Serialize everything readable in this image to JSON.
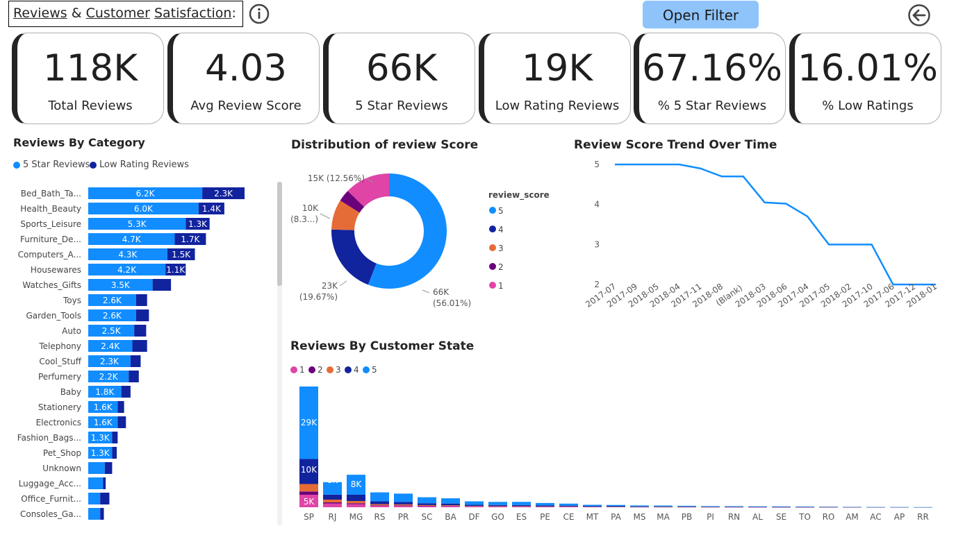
{
  "header": {
    "title_part1": "Reviews",
    "title_amp": " & ",
    "title_part2": "Customer",
    "title_space": " ",
    "title_part3": "Satisfaction",
    "title_colon": ":",
    "open_filter_label": "Open Filter",
    "more_options": "...",
    "info_icon": "info-icon",
    "back_icon": "back-arrow-icon"
  },
  "kpis": [
    {
      "value": "118K",
      "label": "Total Reviews"
    },
    {
      "value": "4.03",
      "label": "Avg Review Score"
    },
    {
      "value": "66K",
      "label": "5 Star Reviews"
    },
    {
      "value": "19K",
      "label": "Low Rating Reviews"
    },
    {
      "value": "67.16%",
      "label": "% 5 Star Reviews"
    },
    {
      "value": "16.01%",
      "label": "% Low Ratings"
    }
  ],
  "colors": {
    "five_star": "#118dff",
    "low_rating": "#12239e",
    "score5": "#118dff",
    "score4": "#12239e",
    "score3": "#e66c37",
    "score2": "#6b007b",
    "score1": "#e044a7",
    "line": "#118dff"
  },
  "category_chart": {
    "title": "Reviews By Category",
    "legend": [
      "5 Star Reviews",
      "Low Rating Reviews"
    ],
    "categories": [
      "Bed_Bath_Ta...",
      "Health_Beauty",
      "Sports_Leisure",
      "Furniture_De...",
      "Computers_A...",
      "Housewares",
      "Watches_Gifts",
      "Toys",
      "Garden_Tools",
      "Auto",
      "Telephony",
      "Cool_Stuff",
      "Perfumery",
      "Baby",
      "Stationery",
      "Electronics",
      "Fashion_Bags...",
      "Pet_Shop",
      "Unknown",
      "Luggage_Acc...",
      "Office_Furnit...",
      "Consoles_Ga..."
    ],
    "five_star": [
      6200,
      6000,
      5300,
      4700,
      4300,
      4200,
      3500,
      2600,
      2600,
      2500,
      2400,
      2300,
      2200,
      1800,
      1600,
      1600,
      1300,
      1300,
      900,
      800,
      650,
      650
    ],
    "low_rating": [
      2300,
      1400,
      1300,
      1700,
      1500,
      1100,
      1000,
      600,
      700,
      650,
      800,
      550,
      550,
      500,
      350,
      450,
      300,
      250,
      400,
      150,
      500,
      200
    ],
    "five_star_labels": [
      "6.2K",
      "6.0K",
      "5.3K",
      "4.7K",
      "4.3K",
      "4.2K",
      "3.5K",
      "2.6K",
      "2.6K",
      "2.5K",
      "2.4K",
      "2.3K",
      "2.2K",
      "1.8K",
      "1.6K",
      "1.6K",
      "1.3K",
      "1.3K",
      "",
      "",
      "",
      ""
    ],
    "low_rating_labels": [
      "2.3K",
      "1.4K",
      "1.3K",
      "1.7K",
      "1.5K",
      "1.1K",
      "",
      "",
      "",
      "",
      "",
      "",
      "",
      "",
      "",
      "",
      "",
      "",
      "",
      "",
      "",
      ""
    ]
  },
  "chart_data": [
    {
      "type": "pie",
      "title": "Distribution of review Score",
      "legend_title": "review_score",
      "labels": [
        "5",
        "4",
        "3",
        "2",
        "1"
      ],
      "values": [
        66000,
        23000,
        10000,
        4000,
        15000
      ],
      "percents": [
        56.01,
        19.67,
        8.3,
        3.4,
        12.56
      ],
      "data_labels": [
        "66K\n(56.01%)",
        "23K\n(19.67%)",
        "10K\n(8.3...)",
        "",
        "15K (12.56%)"
      ]
    },
    {
      "type": "line",
      "title": "Review Score Trend Over Time",
      "x": [
        "2017-07",
        "2017-09",
        "2018-05",
        "2018-04",
        "2017-11",
        "2018-08",
        "(Blank)",
        "2018-03",
        "2018-06",
        "2017-04",
        "2017-05",
        "2018-02",
        "2017-10",
        "2017-06",
        "2017-12",
        "2018-01"
      ],
      "y": [
        5,
        5,
        5,
        5,
        4.9,
        4.7,
        4.7,
        4.05,
        4.02,
        3.7,
        3.0,
        3.0,
        3.0,
        2.0,
        2.0,
        2.0
      ],
      "yticks": [
        "5",
        "4",
        "3",
        "2"
      ],
      "ylim": [
        2,
        5
      ]
    },
    {
      "type": "bar",
      "title": "Reviews By Customer State",
      "legend": [
        "1",
        "2",
        "3",
        "4",
        "5"
      ],
      "categories": [
        "SP",
        "RJ",
        "MG",
        "RS",
        "PR",
        "SC",
        "BA",
        "DF",
        "GO",
        "ES",
        "PE",
        "CE",
        "MT",
        "PA",
        "MS",
        "MA",
        "PB",
        "PI",
        "RN",
        "AL",
        "SE",
        "TO",
        "RO",
        "AM",
        "AC",
        "AP",
        "RR"
      ],
      "series": [
        {
          "name": "1",
          "values": [
            5000,
            1500,
            1200,
            600,
            550,
            420,
            400,
            250,
            230,
            230,
            180,
            170,
            110,
            110,
            70,
            80,
            60,
            50,
            45,
            40,
            30,
            25,
            20,
            15,
            8,
            6,
            4
          ]
        },
        {
          "name": "2",
          "values": [
            1300,
            450,
            400,
            200,
            180,
            130,
            120,
            80,
            70,
            70,
            60,
            55,
            35,
            35,
            25,
            25,
            20,
            15,
            15,
            12,
            10,
            8,
            6,
            5,
            3,
            2,
            2
          ]
        },
        {
          "name": "3",
          "values": [
            3000,
            1100,
            900,
            450,
            420,
            300,
            280,
            180,
            170,
            160,
            130,
            120,
            80,
            80,
            55,
            55,
            45,
            35,
            35,
            30,
            25,
            20,
            15,
            12,
            6,
            5,
            3
          ]
        },
        {
          "name": "4",
          "values": [
            10000,
            2000,
            2500,
            1100,
            1000,
            750,
            680,
            450,
            420,
            400,
            330,
            310,
            200,
            190,
            150,
            150,
            110,
            100,
            95,
            80,
            70,
            60,
            50,
            35,
            15,
            12,
            8
          ]
        },
        {
          "name": "5",
          "values": [
            29000,
            5000,
            8000,
            3600,
            3300,
            2400,
            2100,
            1400,
            1250,
            1300,
            1000,
            800,
            550,
            500,
            430,
            380,
            350,
            260,
            250,
            210,
            180,
            160,
            130,
            90,
            40,
            35,
            25
          ]
        }
      ],
      "data_labels": {
        "SP": [
          "5K",
          "10K",
          "29K"
        ],
        "RJ": [
          "8K"
        ],
        "MG": [
          "8K"
        ]
      }
    }
  ]
}
